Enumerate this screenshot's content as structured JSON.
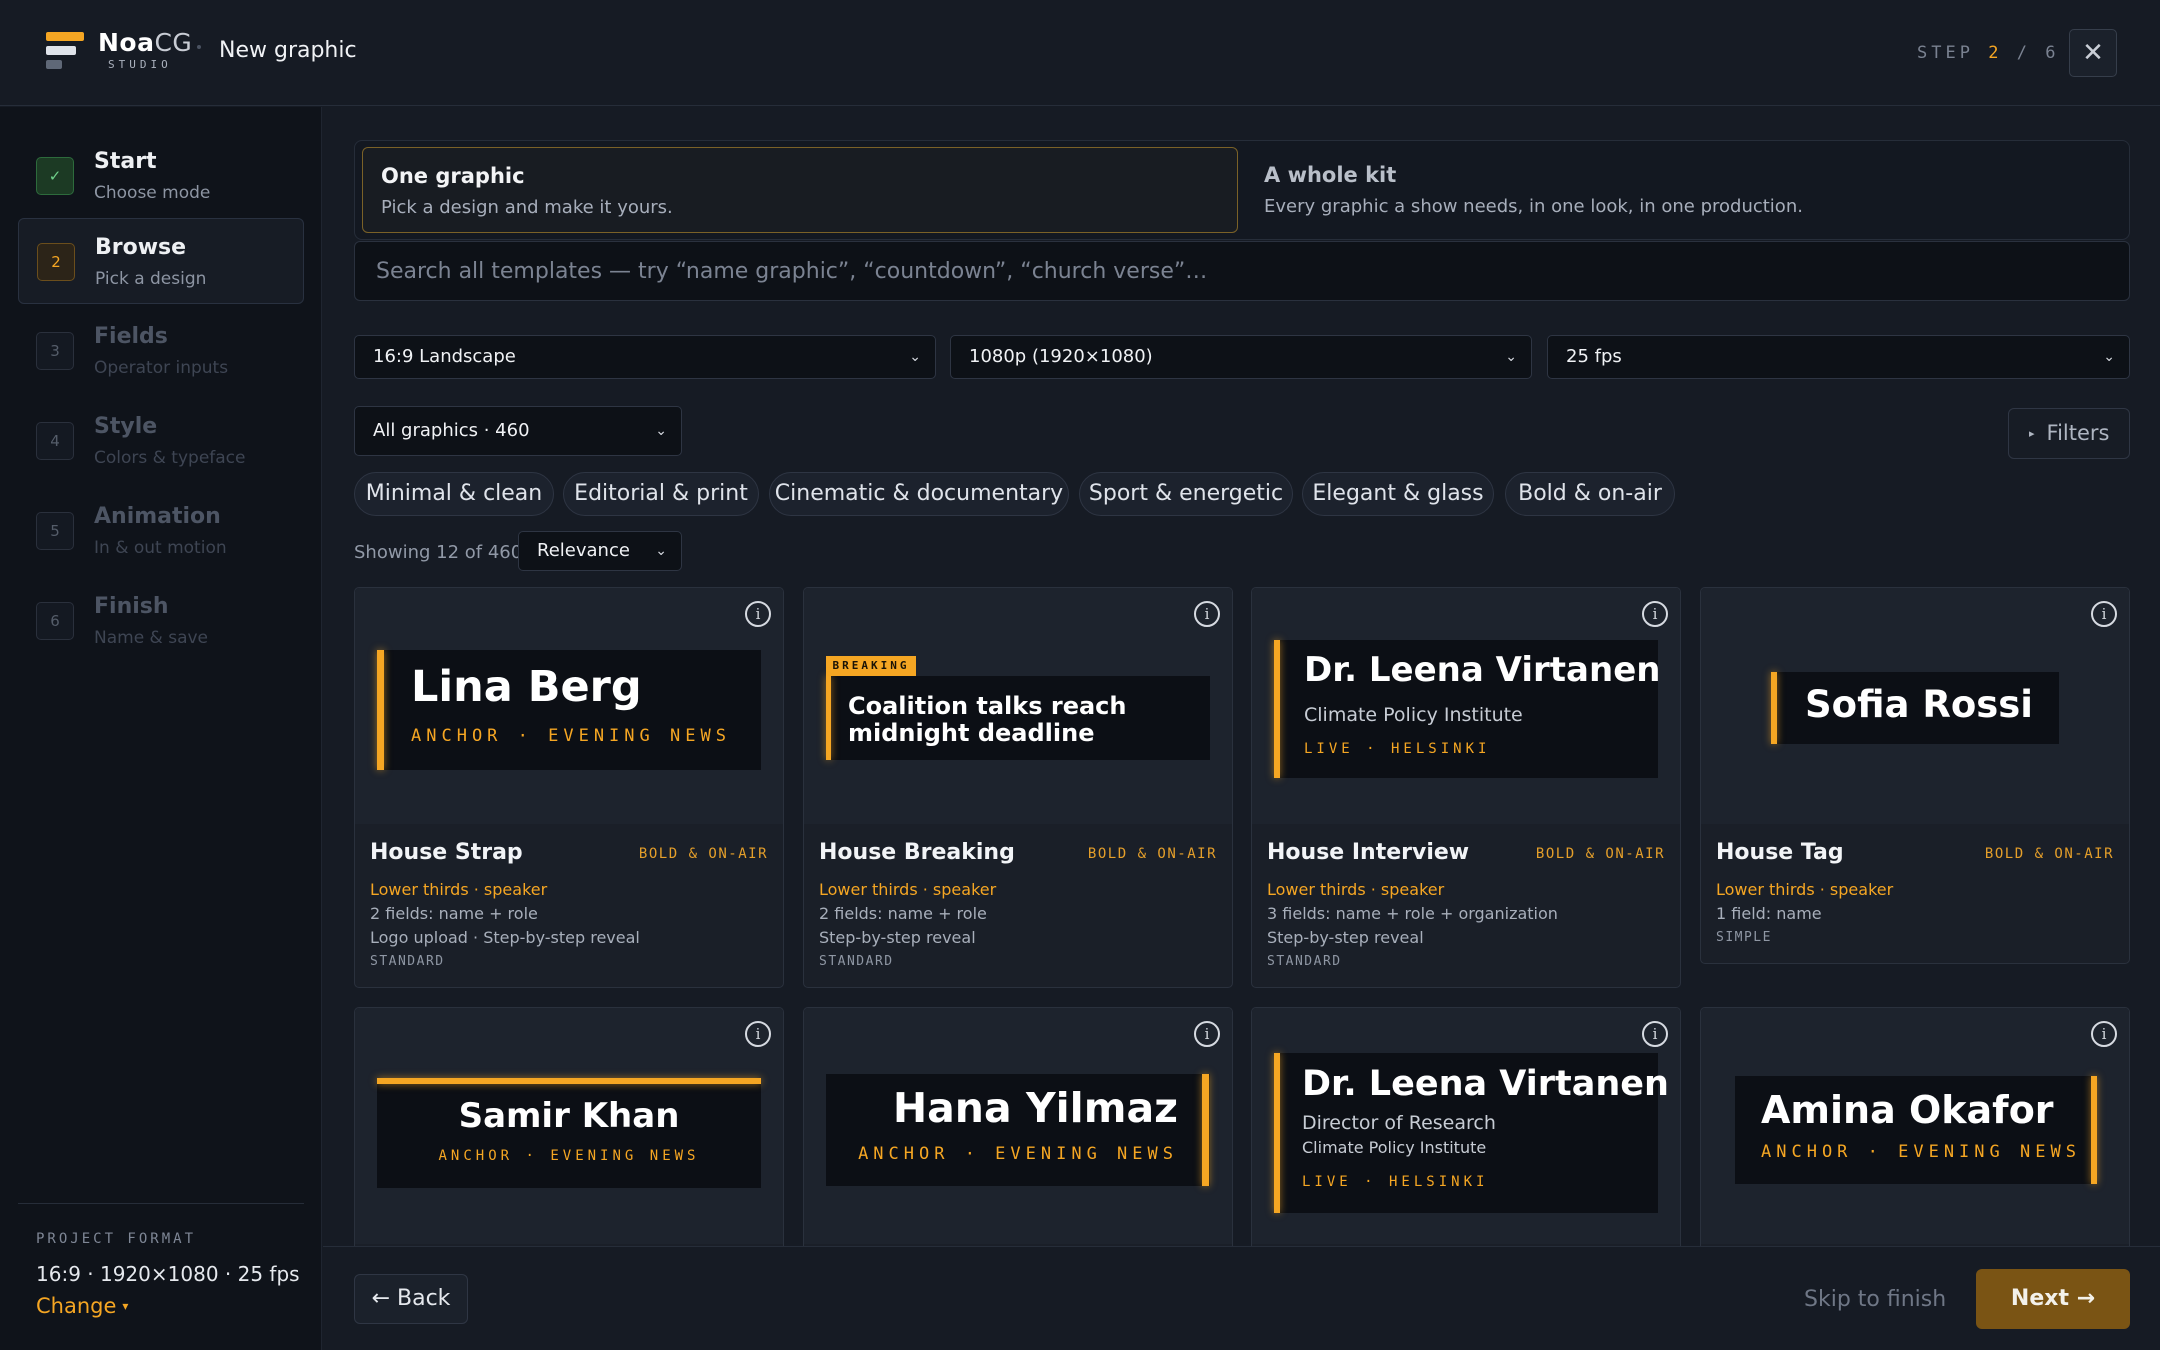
{
  "header": {
    "brand_bold": "Noa",
    "brand_light": "CG",
    "brand_sub": "STUDIO",
    "page_title": "New graphic",
    "step_label": "STEP",
    "step_current": "2",
    "step_sep": "/",
    "step_total": "6",
    "close": "✕"
  },
  "sidebar": {
    "steps": [
      {
        "num": "✓",
        "label": "Start",
        "sub": "Choose mode",
        "state": "done"
      },
      {
        "num": "2",
        "label": "Browse",
        "sub": "Pick a design",
        "state": "active"
      },
      {
        "num": "3",
        "label": "Fields",
        "sub": "Operator inputs",
        "state": "todo"
      },
      {
        "num": "4",
        "label": "Style",
        "sub": "Colors & typeface",
        "state": "todo"
      },
      {
        "num": "5",
        "label": "Animation",
        "sub": "In & out motion",
        "state": "todo"
      },
      {
        "num": "6",
        "label": "Finish",
        "sub": "Name & save",
        "state": "todo"
      }
    ],
    "project_format_title": "PROJECT FORMAT",
    "project_format_value": "16:9 · 1920×1080 · 25 fps",
    "change_label": "Change",
    "change_caret": "▾"
  },
  "mode": {
    "one_title": "One graphic",
    "one_desc": "Pick a design and make it yours.",
    "kit_title": "A whole kit",
    "kit_desc": "Every graphic a show needs, in one look, in one production."
  },
  "search": {
    "placeholder": "Search all templates — try “name graphic”, “countdown”, “church verse”…",
    "value": ""
  },
  "format_selects": {
    "aspect": "16:9 Landscape",
    "resolution": "1080p (1920×1080)",
    "fps": "25 fps"
  },
  "category_select": "All graphics · 460",
  "filters_label": "Filters",
  "filters_icon": "▸",
  "chips": [
    "Minimal & clean",
    "Editorial & print",
    "Cinematic & documentary",
    "Sport & energetic",
    "Elegant & glass",
    "Bold & on-air"
  ],
  "results": {
    "showing": "Showing 12 of 460",
    "sort": "Relevance"
  },
  "chevron": "⌄",
  "info_glyph": "i",
  "cards": [
    {
      "name": "House Strap",
      "tag": "BOLD & ON-AIR",
      "category": "Lower thirds · speaker",
      "line1": "2 fields: name + role",
      "line2": "Logo upload · Step-by-step reveal",
      "tier": "STANDARD",
      "preview": {
        "name": "Lina Berg",
        "role": "ANCHOR · EVENING NEWS"
      }
    },
    {
      "name": "House Breaking",
      "tag": "BOLD & ON-AIR",
      "category": "Lower thirds · speaker",
      "line1": "2 fields: name + role",
      "line2": "Step-by-step reveal",
      "tier": "STANDARD",
      "preview": {
        "badge": "BREAKING",
        "line1": "Coalition talks reach",
        "line2": "midnight deadline"
      }
    },
    {
      "name": "House Interview",
      "tag": "BOLD & ON-AIR",
      "category": "Lower thirds · speaker",
      "line1": "3 fields: name + role + organization",
      "line2": "Step-by-step reveal",
      "tier": "STANDARD",
      "preview": {
        "name": "Dr. Leena Virtanen",
        "sub": "Climate Policy Institute",
        "role": "LIVE · HELSINKI"
      }
    },
    {
      "name": "House Tag",
      "tag": "BOLD & ON-AIR",
      "category": "Lower thirds · speaker",
      "line1": "1 field: name",
      "line2": "",
      "tier": "SIMPLE",
      "preview": {
        "name": "Sofia Rossi"
      }
    },
    {
      "preview": {
        "name": "Samir Khan",
        "role": "ANCHOR · EVENING NEWS"
      }
    },
    {
      "preview": {
        "name": "Hana Yilmaz",
        "role": "ANCHOR · EVENING NEWS"
      }
    },
    {
      "preview": {
        "name": "Dr. Leena Virtanen",
        "sub": "Director of Research",
        "sub2": "Climate Policy Institute",
        "role": "LIVE · HELSINKI"
      }
    },
    {
      "preview": {
        "name": "Amina Okafor",
        "role": "ANCHOR · EVENING NEWS"
      }
    }
  ],
  "footer": {
    "back": "← Back",
    "skip": "Skip to finish",
    "next": "Next →"
  },
  "colors": {
    "accent": "#f5a623",
    "background": "#161b24",
    "sidebar": "#0f131a",
    "done_green": "#6fd08a"
  }
}
